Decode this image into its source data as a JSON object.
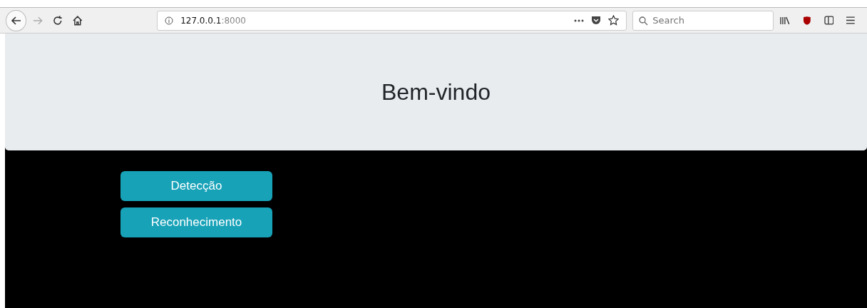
{
  "browser": {
    "url_host": "127.0.0.1",
    "url_port": ":8000",
    "search_placeholder": "Search"
  },
  "jumbotron": {
    "title": "Bem-vindo"
  },
  "buttons": [
    {
      "label": "Detecção"
    },
    {
      "label": "Reconhecimento"
    }
  ]
}
